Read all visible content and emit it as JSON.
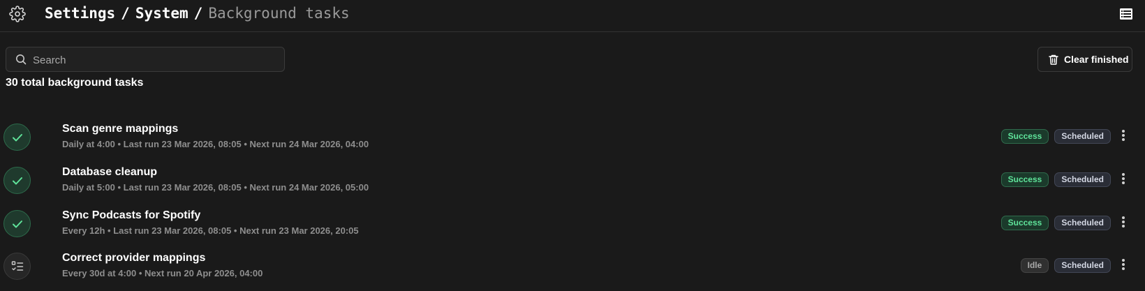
{
  "header": {
    "breadcrumb": [
      "Settings",
      "System",
      "Background tasks"
    ],
    "separator": "/",
    "settings_icon": "gear-icon",
    "view_icon": "list-view-icon"
  },
  "search": {
    "placeholder": "Search",
    "value": "",
    "icon": "search-icon"
  },
  "toolbar": {
    "clear_label": "Clear finished",
    "clear_icon": "trash-icon"
  },
  "summary": {
    "total_text": "30 total background tasks"
  },
  "colors": {
    "background": "#1a1a1a",
    "success": "#5fe39a",
    "muted_text": "#8e8e8e"
  },
  "tasks": [
    {
      "name": "Scan genre mappings",
      "meta": "Daily at 4:00 • Last run 23 Mar 2026, 08:05 • Next run 24 Mar 2026, 04:00",
      "status": "Success",
      "mode": "Scheduled",
      "icon": "check-icon"
    },
    {
      "name": "Database cleanup",
      "meta": "Daily at 5:00 • Last run 23 Mar 2026, 08:05 • Next run 24 Mar 2026, 05:00",
      "status": "Success",
      "mode": "Scheduled",
      "icon": "check-icon"
    },
    {
      "name": "Sync Podcasts for Spotify",
      "meta": "Every 12h • Last run 23 Mar 2026, 08:05 • Next run 23 Mar 2026, 20:05",
      "status": "Success",
      "mode": "Scheduled",
      "icon": "check-icon"
    },
    {
      "name": "Correct provider mappings",
      "meta": "Every 30d at 4:00 • Next run 20 Apr 2026, 04:00",
      "status": "Idle",
      "mode": "Scheduled",
      "icon": "checklist-icon"
    }
  ]
}
